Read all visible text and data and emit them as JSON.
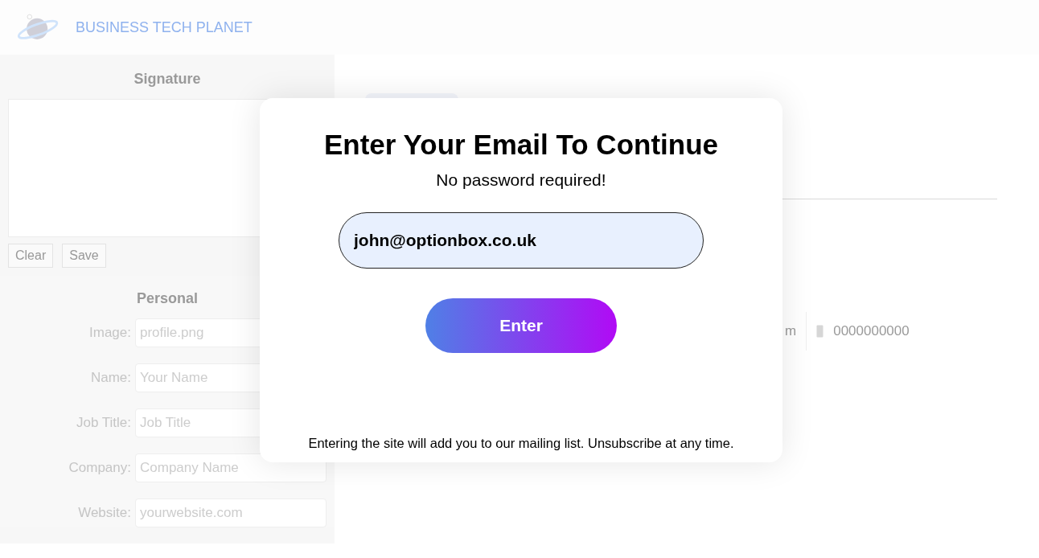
{
  "header": {
    "brand": "BUSINESS TECH PLANET"
  },
  "signature": {
    "title": "Signature",
    "buttons": [
      "Clear",
      "Save"
    ]
  },
  "personal": {
    "title": "Personal",
    "fields": [
      {
        "label": "Image:",
        "placeholder": "profile.png"
      },
      {
        "label": "Name:",
        "placeholder": "Your Name"
      },
      {
        "label": "Job Title:",
        "placeholder": "Job Title"
      },
      {
        "label": "Company:",
        "placeholder": "Company Name"
      },
      {
        "label": "Website:",
        "placeholder": "yourwebsite.com"
      }
    ]
  },
  "preview": {
    "email_fragment": "m",
    "phone": "0000000000"
  },
  "modal": {
    "title": "Enter Your Email To Continue",
    "subtitle": "No password required!",
    "email": "john@optionbox.co.uk",
    "button": "Enter",
    "footer": "Entering the site will add you to our mailing list. Unsubscribe at any time."
  }
}
